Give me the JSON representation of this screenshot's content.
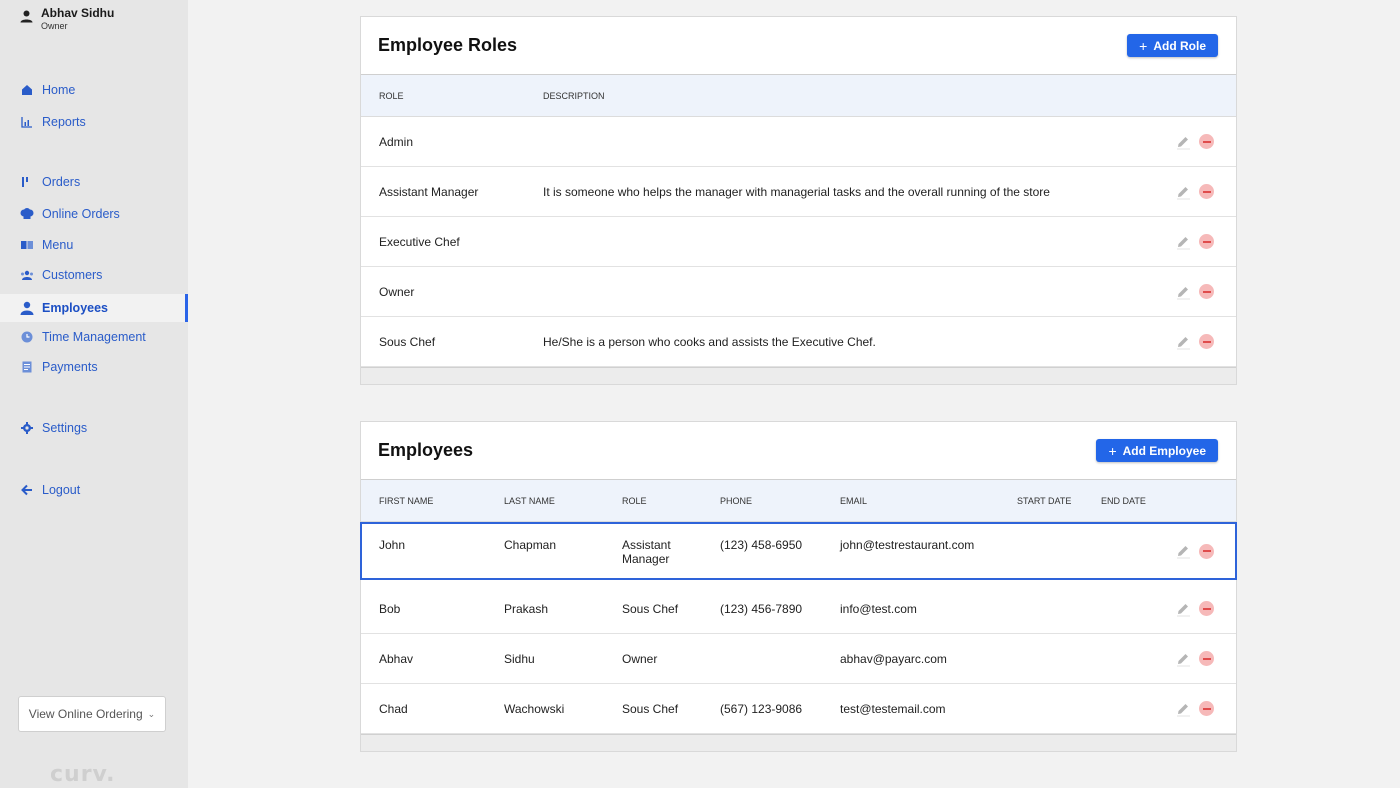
{
  "user": {
    "name": "Abhav Sidhu",
    "role": "Owner"
  },
  "nav": [
    {
      "label": "Home",
      "icon": "home-icon"
    },
    {
      "label": "Reports",
      "icon": "reports-icon"
    },
    {
      "label": "Orders",
      "icon": "orders-icon"
    },
    {
      "label": "Online Orders",
      "icon": "chef-hat-icon"
    },
    {
      "label": "Menu",
      "icon": "menu-book-icon"
    },
    {
      "label": "Customers",
      "icon": "customers-icon"
    },
    {
      "label": "Employees",
      "icon": "employee-icon"
    },
    {
      "label": "Time Management",
      "icon": "clock-icon"
    },
    {
      "label": "Payments",
      "icon": "payments-icon"
    },
    {
      "label": "Settings",
      "icon": "gear-icon"
    },
    {
      "label": "Logout",
      "icon": "arrow-left-icon"
    }
  ],
  "active_nav": "Employees",
  "view_online": "View Online Ordering",
  "logo": "curv.",
  "roles": {
    "title": "Employee Roles",
    "add_label": "Add Role",
    "headers": {
      "role": "ROLE",
      "description": "DESCRIPTION"
    },
    "rows": [
      {
        "role": "Admin",
        "description": ""
      },
      {
        "role": "Assistant Manager",
        "description": "It is someone who helps the manager with managerial tasks and the overall running of the store"
      },
      {
        "role": "Executive Chef",
        "description": ""
      },
      {
        "role": "Owner",
        "description": ""
      },
      {
        "role": "Sous Chef",
        "description": "He/She is a person who cooks and assists the Executive Chef."
      }
    ]
  },
  "employees": {
    "title": "Employees",
    "add_label": "Add Employee",
    "headers": {
      "first": "FIRST NAME",
      "last": "LAST NAME",
      "role": "ROLE",
      "phone": "PHONE",
      "email": "EMAIL",
      "start": "START DATE",
      "end": "END DATE"
    },
    "rows": [
      {
        "first": "John",
        "last": "Chapman",
        "role_line1": "Assistant",
        "role_line2": "Manager",
        "phone": "(123) 458-6950",
        "email": "john@testrestaurant.com"
      },
      {
        "first": "Bob",
        "last": "Prakash",
        "role_line1": "Sous Chef",
        "role_line2": "",
        "phone": "(123) 456-7890",
        "email": "info@test.com"
      },
      {
        "first": "Abhav",
        "last": "Sidhu",
        "role_line1": "Owner",
        "role_line2": "",
        "phone": "",
        "email": "abhav@payarc.com"
      },
      {
        "first": "Chad",
        "last": "Wachowski",
        "role_line1": "Sous Chef",
        "role_line2": "",
        "phone": "(567) 123-9086",
        "email": "test@testemail.com"
      }
    ]
  },
  "colors": {
    "accent": "#2366e8",
    "nav_text": "#2a5cc9",
    "delete": "#e04b4b"
  }
}
